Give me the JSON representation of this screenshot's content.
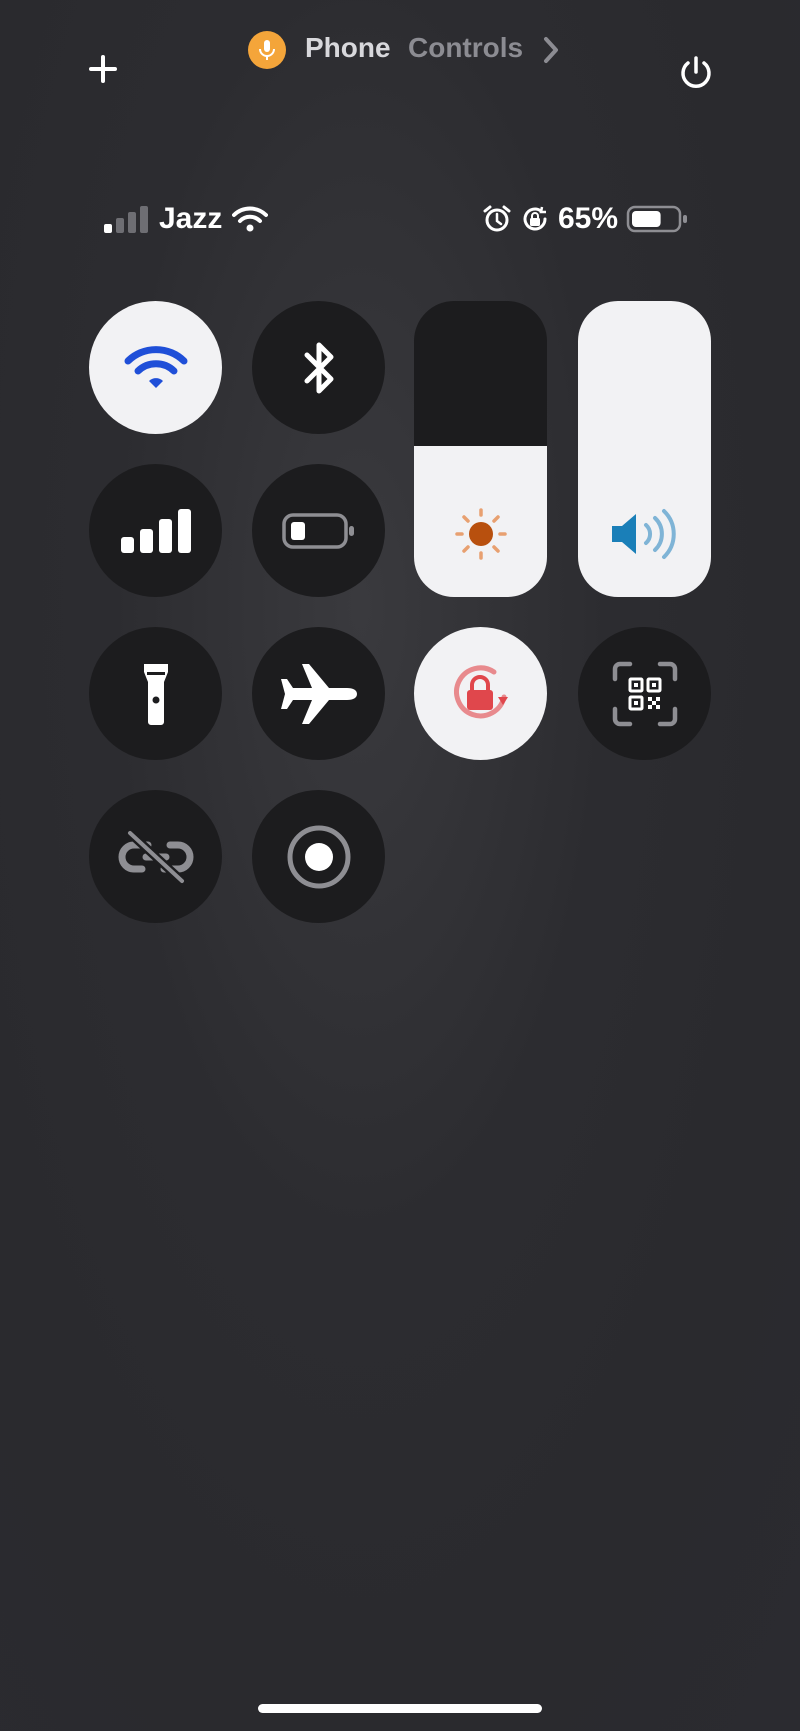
{
  "header": {
    "app_name": "Phone",
    "section": "Controls"
  },
  "status_bar": {
    "carrier": "Jazz",
    "battery_percent": "65%",
    "battery_level": 0.65,
    "signal_bars": 1
  },
  "controls": {
    "wifi": {
      "state": "on",
      "accent": "#1f4fd8"
    },
    "bluetooth": {
      "state": "off"
    },
    "cellular_data": {
      "state": "off"
    },
    "low_power_mode": {
      "state": "off"
    },
    "brightness": {
      "level": 0.51,
      "accent": "#d2691e"
    },
    "volume": {
      "level": 1.0,
      "accent": "#1a7fb8"
    },
    "flashlight": {
      "state": "off"
    },
    "airplane_mode": {
      "state": "off"
    },
    "orientation_lock": {
      "state": "on",
      "accent": "#e0474c"
    },
    "code_scanner": {
      "state": "off"
    },
    "hotspot": {
      "state": "off"
    },
    "screen_recording": {
      "state": "off"
    }
  },
  "colors": {
    "mic_indicator": "#f4a53a",
    "tile_off": "#1c1c1e",
    "tile_on": "#f2f2f4"
  }
}
